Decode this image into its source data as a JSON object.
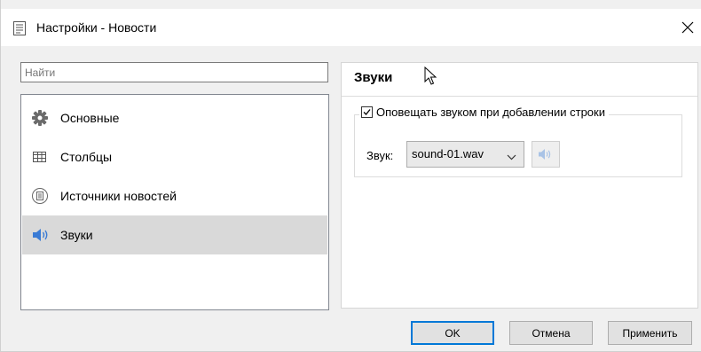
{
  "window": {
    "title": "Настройки - Новости",
    "icon": "document-icon",
    "close_icon": "close-icon"
  },
  "search": {
    "placeholder": "Найти",
    "value": ""
  },
  "sidebar": {
    "items": [
      {
        "label": "Основные",
        "icon": "gear-icon",
        "selected": false
      },
      {
        "label": "Столбцы",
        "icon": "table-icon",
        "selected": false
      },
      {
        "label": "Источники новостей",
        "icon": "news-source-icon",
        "selected": false
      },
      {
        "label": "Звуки",
        "icon": "speaker-icon",
        "selected": true
      }
    ]
  },
  "main": {
    "title": "Звуки",
    "notify_checkbox": {
      "label": "Оповещать звуком при добавлении строки",
      "checked": true
    },
    "sound_label": "Звук:",
    "sound_select": {
      "value": "sound-01.wav"
    },
    "play_button_icon": "speaker-icon"
  },
  "buttons": {
    "ok": "OK",
    "cancel": "Отмена",
    "apply": "Применить"
  },
  "colors": {
    "accent": "#0078d7",
    "selected_bg": "#d9d9d9",
    "speaker_blue": "#3a7bd5"
  }
}
